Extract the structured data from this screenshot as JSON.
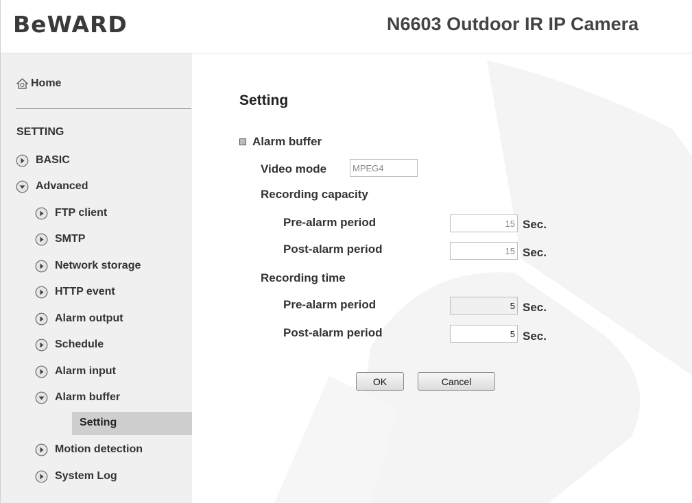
{
  "header": {
    "logo": "BeWARD",
    "model_title": "N6603 Outdoor IR IP Camera"
  },
  "sidebar": {
    "home_label": "Home",
    "section_label": "SETTING",
    "items": [
      {
        "label": "BASIC",
        "expanded": false
      },
      {
        "label": "Advanced",
        "expanded": true
      },
      {
        "label": "FTP client",
        "expanded": false
      },
      {
        "label": "SMTP",
        "expanded": false
      },
      {
        "label": "Network storage",
        "expanded": false
      },
      {
        "label": "HTTP event",
        "expanded": false
      },
      {
        "label": "Alarm output",
        "expanded": false
      },
      {
        "label": "Schedule",
        "expanded": false
      },
      {
        "label": "Alarm input",
        "expanded": false
      },
      {
        "label": "Alarm buffer",
        "expanded": true
      },
      {
        "label": "Setting",
        "selected": true
      },
      {
        "label": "Motion detection",
        "expanded": false
      },
      {
        "label": "System Log",
        "expanded": false
      }
    ]
  },
  "main": {
    "title": "Setting",
    "section": "Alarm buffer",
    "video_mode_label": "Video mode",
    "video_mode_value": "MPEG4",
    "recording_capacity_label": "Recording capacity",
    "capacity_pre_label": "Pre-alarm period",
    "capacity_pre_value": "15",
    "capacity_post_label": "Post-alarm period",
    "capacity_post_value": "15",
    "recording_time_label": "Recording time",
    "time_pre_label": "Pre-alarm period",
    "time_pre_value": "5",
    "time_post_label": "Post-alarm period",
    "time_post_value": "5",
    "unit": "Sec.",
    "ok_label": "OK",
    "cancel_label": "Cancel"
  },
  "icons": {
    "home": "home-icon",
    "bullet_collapsed": "arrow-right-bullet-icon",
    "bullet_expanded": "arrow-down-bullet-icon",
    "section_marker": "square-bullet-icon"
  },
  "colors": {
    "sidebar_bg": "#f0f0f0",
    "selected_bg": "#cfcfcf",
    "watermark": "#f3f3f3",
    "text": "#333333"
  }
}
